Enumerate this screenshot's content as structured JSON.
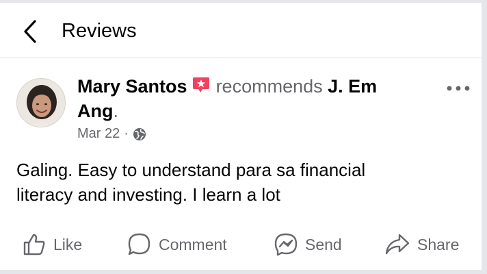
{
  "header": {
    "title": "Reviews",
    "back_icon": "chevron-left-icon"
  },
  "post": {
    "author": "Mary Santos",
    "verb": "recommends",
    "page": "J. Em Ang",
    "period": ".",
    "date": "Mar 22",
    "separator": "·",
    "audience_icon": "globe-icon",
    "badge_icon": "recommend-star-icon",
    "badge_color": "#f3425f",
    "more_icon": "more-horizontal-icon",
    "text_line1": "Galing. Easy to understand para sa financial",
    "text_line2": "literacy and investing. I learn a lot"
  },
  "actions": {
    "like": "Like",
    "comment": "Comment",
    "send": "Send",
    "share": "Share"
  },
  "colors": {
    "text_primary": "#050505",
    "text_secondary": "#65676b",
    "divider": "#dcdfe3"
  }
}
